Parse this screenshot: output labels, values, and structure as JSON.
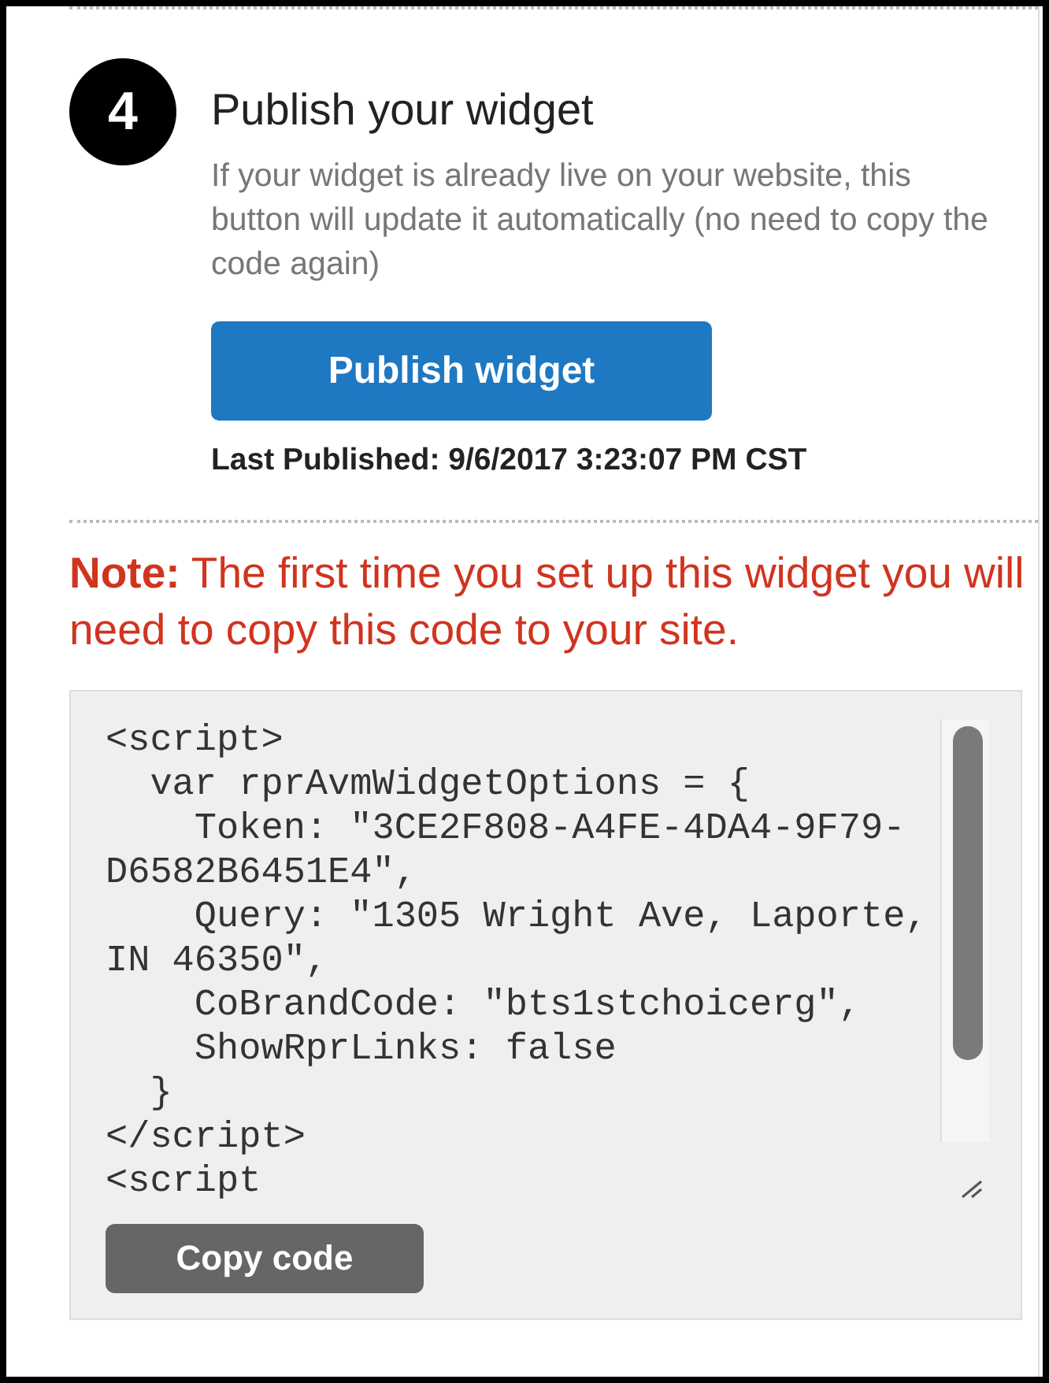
{
  "step": {
    "number": "4",
    "title": "Publish your widget",
    "description": "If your widget is already live on your website, this button will update it automatically (no need to copy the code again)",
    "button": "Publish widget",
    "last_published": "Last Published: 9/6/2017 3:23:07 PM CST"
  },
  "note": "**Note:** The first time you set up this widget you will need to copy this code to your site.",
  "code": {
    "lines": [
      "<script>",
      "  var rprAvmWidgetOptions = {",
      "    Token: \"3CE2F808-A4FE-4DA4-9F79-",
      "D6582B6451E4\",",
      "    Query: \"1305 Wright Ave, Laporte,",
      "IN 46350\",",
      "    CoBrandCode: \"bts1stchoicerg\",",
      "    ShowRprLinks: false",
      "  }",
      "</script>",
      "<script"
    ],
    "button": "Copy code"
  }
}
